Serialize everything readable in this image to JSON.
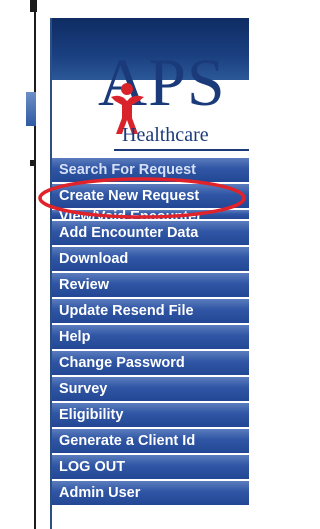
{
  "logo": {
    "brand": "APS",
    "tagline": "Healthcare"
  },
  "menu": {
    "items": [
      "Search For Request",
      "Create New Request",
      "View/Void Encounter",
      "Add Encounter Data",
      "Download",
      "Review",
      "Update Resend File",
      "Help",
      "Change Password",
      "Survey",
      "Eligibility",
      "Generate a Client Id",
      "LOG OUT",
      "Admin User"
    ]
  },
  "colors": {
    "menu_button": "#2f55a4",
    "menu_text": "#ffffff",
    "highlight": "#e0232a",
    "logo_blue": "#1a3a7a",
    "logo_red": "#d8232a"
  },
  "annotation": {
    "shape": "ellipse",
    "target": "Create New Request",
    "color": "#e0232a"
  }
}
